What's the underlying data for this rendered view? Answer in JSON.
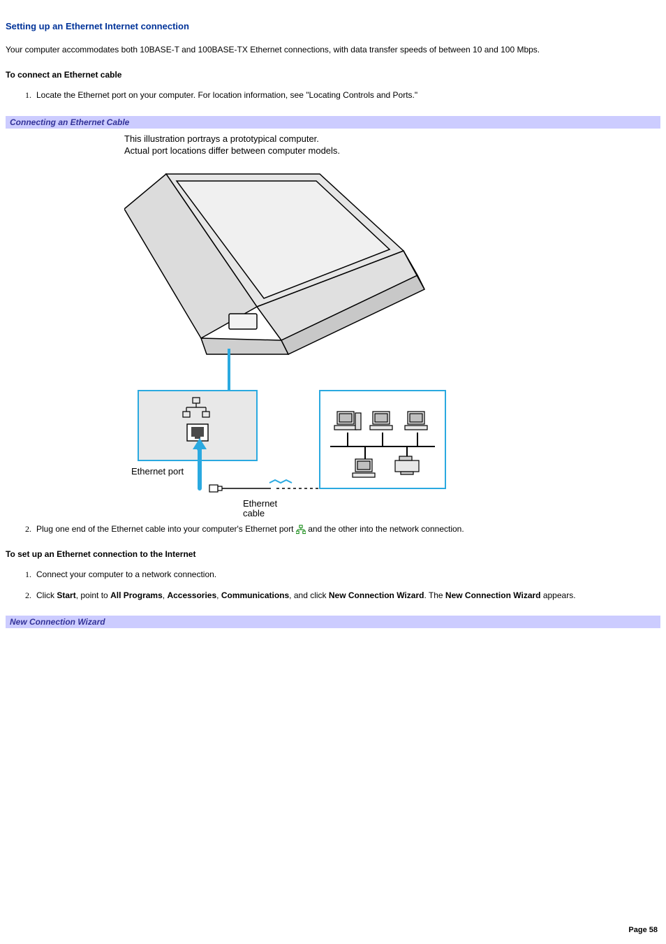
{
  "title": "Setting up an Ethernet Internet connection",
  "intro": "Your computer accommodates both 10BASE-T and 100BASE-TX Ethernet connections, with data transfer speeds of between 10 and 100 Mbps.",
  "sectionA": {
    "heading": "To connect an Ethernet cable",
    "step1": "Locate the Ethernet port on your computer. For location information, see \"Locating Controls and Ports.\"",
    "caption": "Connecting an Ethernet Cable",
    "figureNote1": "This illustration portrays a prototypical computer.",
    "figureNote2": "Actual port locations differ between computer models.",
    "labels": {
      "ethernetPort": "Ethernet port",
      "ethernet": "Ethernet",
      "cable": "cable"
    },
    "step2a": "Plug one end of the Ethernet cable into your computer's Ethernet port ",
    "step2b": " and the other into the network connection."
  },
  "sectionB": {
    "heading": "To set up an Ethernet connection to the Internet",
    "step1": "Connect your computer to a network connection.",
    "step2_pre": "Click ",
    "step2_b1": "Start",
    "step2_mid1": ", point to ",
    "step2_b2": "All Programs",
    "step2_mid2": ", ",
    "step2_b3": "Accessories",
    "step2_mid3": ", ",
    "step2_b4": "Communications",
    "step2_mid4": ", and click ",
    "step2_b5": "New Connection Wizard",
    "step2_mid5": ". The ",
    "step2_b6": "New Connection Wizard",
    "step2_post": " appears.",
    "caption": "New Connection Wizard"
  },
  "pageNumber": "Page 58"
}
